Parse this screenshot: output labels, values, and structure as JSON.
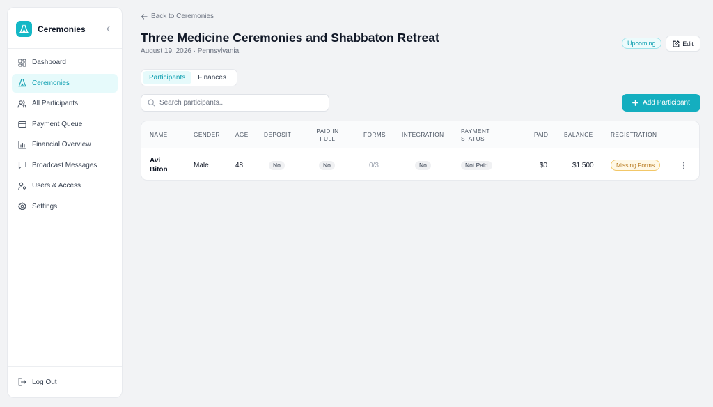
{
  "sidebar": {
    "brand": "Ceremonies",
    "items": [
      {
        "label": "Dashboard",
        "icon": "dashboard-icon"
      },
      {
        "label": "Ceremonies",
        "icon": "ceremony-icon",
        "active": true
      },
      {
        "label": "All Participants",
        "icon": "users-icon"
      },
      {
        "label": "Payment Queue",
        "icon": "credit-card-icon"
      },
      {
        "label": "Financial Overview",
        "icon": "bar-chart-icon"
      },
      {
        "label": "Broadcast Messages",
        "icon": "message-icon"
      },
      {
        "label": "Users & Access",
        "icon": "user-key-icon"
      },
      {
        "label": "Settings",
        "icon": "gear-icon"
      }
    ],
    "logout": "Log Out"
  },
  "header": {
    "back_label": "Back to Ceremonies",
    "title": "Three Medicine Ceremonies and Shabbaton Retreat",
    "subtitle": "August 19, 2026 · Pennsylvania",
    "status": "Upcoming",
    "edit_label": "Edit"
  },
  "tabs": [
    {
      "label": "Participants",
      "active": true
    },
    {
      "label": "Finances",
      "active": false
    }
  ],
  "search": {
    "placeholder": "Search participants..."
  },
  "add_button": "Add Participant",
  "table": {
    "columns": [
      "Name",
      "Gender",
      "Age",
      "Deposit",
      "Paid in Full",
      "Forms",
      "Integration",
      "Payment Status",
      "Paid",
      "Balance",
      "Registration"
    ],
    "rows": [
      {
        "name": "Avi Biton",
        "gender": "Male",
        "age": "48",
        "deposit": "No",
        "paid_in_full": "No",
        "forms": "0/3",
        "integration": "No",
        "payment_status": "Not Paid",
        "paid": "$0",
        "balance": "$1,500",
        "registration": "Missing Forms"
      }
    ]
  },
  "colors": {
    "accent": "#14aebf",
    "accent_light": "#e6fafb",
    "warning": "#b7791f"
  }
}
